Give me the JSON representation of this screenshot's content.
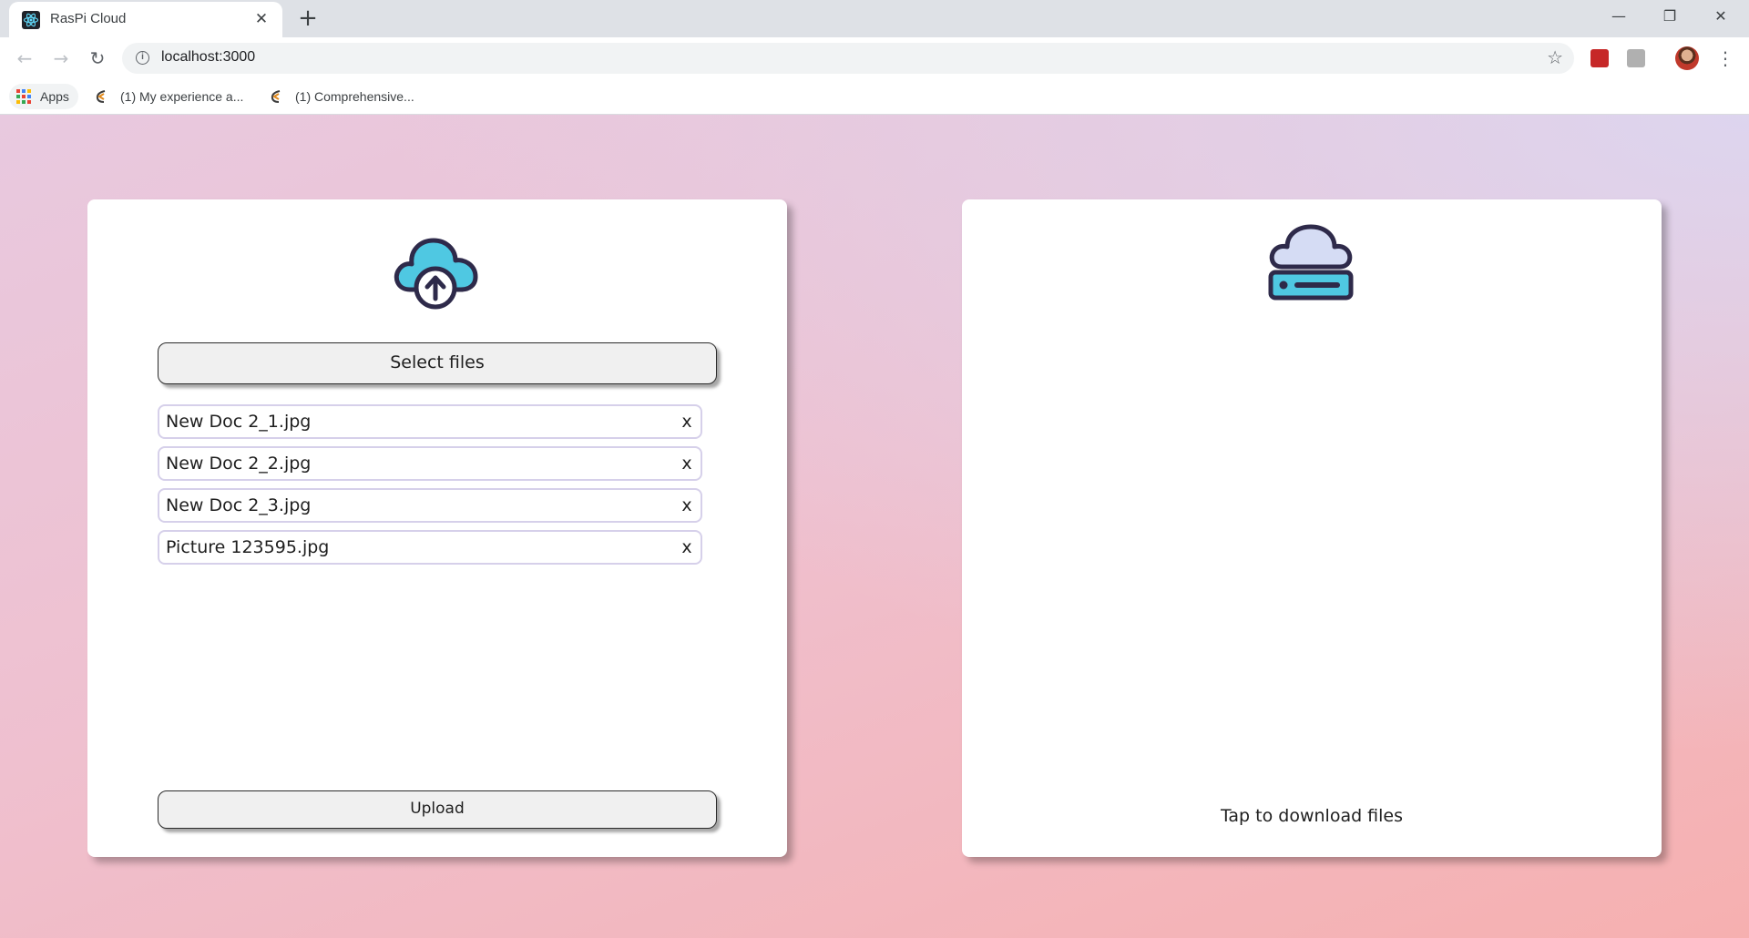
{
  "browser": {
    "tab_title": "RasPi Cloud",
    "tab_close": "✕",
    "new_tab": "+",
    "url": "localhost:3000",
    "window_controls": {
      "minimize": "—",
      "restore": "❐",
      "close": "✕"
    },
    "bookmarks": {
      "apps_label": "Apps",
      "items": [
        {
          "label": "(1) My experience a..."
        },
        {
          "label": "(1) Comprehensive..."
        }
      ]
    }
  },
  "app": {
    "upload_panel": {
      "select_button": "Select files",
      "files": [
        {
          "name": "New Doc 2_1.jpg",
          "remove": "x"
        },
        {
          "name": "New Doc 2_2.jpg",
          "remove": "x"
        },
        {
          "name": "New Doc 2_3.jpg",
          "remove": "x"
        },
        {
          "name": "Picture 123595.jpg",
          "remove": "x"
        }
      ],
      "upload_button": "Upload"
    },
    "download_panel": {
      "label": "Tap to download files"
    }
  },
  "colors": {
    "cloud_fill": "#4fc8e2",
    "cloud_outline": "#2e2a4a",
    "server_cloud_fill": "#d5dcf4",
    "server_base_fill": "#4fc8e2",
    "file_border": "#d6d0ea"
  }
}
